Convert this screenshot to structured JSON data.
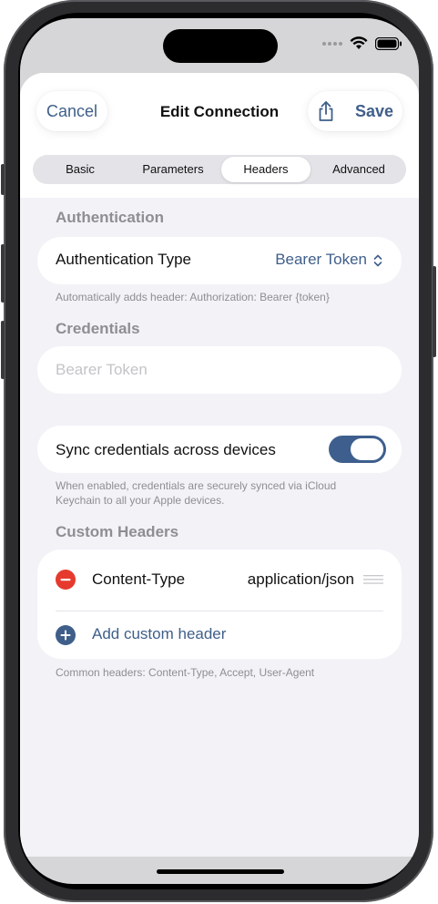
{
  "header": {
    "cancel_label": "Cancel",
    "title": "Edit Connection",
    "save_label": "Save"
  },
  "tabs": [
    {
      "label": "Basic",
      "active": false
    },
    {
      "label": "Parameters",
      "active": false
    },
    {
      "label": "Headers",
      "active": true
    },
    {
      "label": "Advanced",
      "active": false
    }
  ],
  "authentication": {
    "section_title": "Authentication",
    "type_label": "Authentication Type",
    "type_value": "Bearer Token",
    "footnote": "Automatically adds header: Authorization: Bearer {token}"
  },
  "credentials": {
    "section_title": "Credentials",
    "token_placeholder": "Bearer Token",
    "token_value": "",
    "sync_label": "Sync credentials across devices",
    "sync_enabled": true,
    "sync_footnote": "When enabled, credentials are securely synced via iCloud Keychain to all your Apple devices."
  },
  "custom_headers": {
    "section_title": "Custom Headers",
    "items": [
      {
        "name": "Content-Type",
        "value": "application/json"
      }
    ],
    "add_label": "Add custom header",
    "footnote": "Common headers: Content-Type, Accept, User-Agent"
  },
  "colors": {
    "accent": "#3f5f8a",
    "toggle_on": "#3e5f8e",
    "destructive": "#e63a2e",
    "background": "#f2f2f7"
  },
  "icons": [
    "wifi-icon",
    "battery-icon",
    "share-icon",
    "chevron-up-down-icon",
    "remove-icon",
    "drag-handle-icon",
    "add-icon"
  ]
}
